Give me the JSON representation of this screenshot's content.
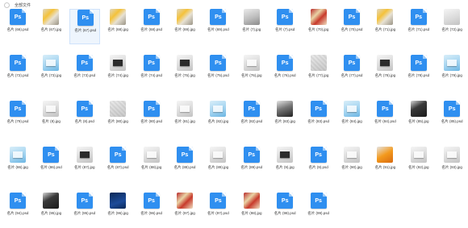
{
  "header": {
    "title": "全部文件"
  },
  "files": [
    {
      "label": "名片 (66).psd",
      "kind": "psd"
    },
    {
      "label": "名片 (67).jpg",
      "kind": "img",
      "thumb": "img-yellow"
    },
    {
      "label": "名片 (67).psd",
      "kind": "psd",
      "selected": true
    },
    {
      "label": "名片 (68).jpg",
      "kind": "img",
      "thumb": "img-yellow"
    },
    {
      "label": "名片 (68).psd",
      "kind": "psd"
    },
    {
      "label": "名片 (69).jpg",
      "kind": "img",
      "thumb": "img-yellow"
    },
    {
      "label": "名片 (69).psd",
      "kind": "psd"
    },
    {
      "label": "名片 (7).jpg",
      "kind": "img",
      "thumb": "img-gray"
    },
    {
      "label": "名片 (7).psd",
      "kind": "psd"
    },
    {
      "label": "名片 (70).jpg",
      "kind": "img",
      "thumb": "img-red"
    },
    {
      "label": "名片 (70).psd",
      "kind": "psd"
    },
    {
      "label": "名片 (71).jpg",
      "kind": "img",
      "thumb": "img-yellow"
    },
    {
      "label": "名片 (71).psd",
      "kind": "psd"
    },
    {
      "label": "名片 (72).jpg",
      "kind": "img",
      "thumb": "img-light"
    },
    {
      "label": "名片 (72).psd",
      "kind": "psd"
    },
    {
      "label": "名片 (73).jpg",
      "kind": "img",
      "thumb": "img-blue img-card"
    },
    {
      "label": "名片 (73).psd",
      "kind": "psd"
    },
    {
      "label": "名片 (74).jpg",
      "kind": "img",
      "thumb": "img-light img-darkcard"
    },
    {
      "label": "名片 (74).psd",
      "kind": "psd"
    },
    {
      "label": "名片 (75).jpg",
      "kind": "img",
      "thumb": "img-light img-darkcard"
    },
    {
      "label": "名片 (75).psd",
      "kind": "psd"
    },
    {
      "label": "名片 (76).jpg",
      "kind": "img",
      "thumb": "img-light img-card"
    },
    {
      "label": "名片 (76).psd",
      "kind": "psd"
    },
    {
      "label": "名片 (77).jpg",
      "kind": "img",
      "thumb": "img-pattern"
    },
    {
      "label": "名片 (77).psd",
      "kind": "psd"
    },
    {
      "label": "名片 (78).jpg",
      "kind": "img",
      "thumb": "img-light img-darkcard"
    },
    {
      "label": "名片 (78).psd",
      "kind": "psd"
    },
    {
      "label": "名片 (79).jpg",
      "kind": "img",
      "thumb": "img-blue img-card"
    },
    {
      "label": "名片 (79).psd",
      "kind": "psd"
    },
    {
      "label": "名片 (8).jpg",
      "kind": "img",
      "thumb": "img-light img-card"
    },
    {
      "label": "名片 (8).psd",
      "kind": "psd"
    },
    {
      "label": "名片 (80).jpg",
      "kind": "img",
      "thumb": "img-pattern"
    },
    {
      "label": "名片 (80).psd",
      "kind": "psd"
    },
    {
      "label": "名片 (81).jpg",
      "kind": "img",
      "thumb": "img-light img-card"
    },
    {
      "label": "名片 (82).jpg",
      "kind": "img",
      "thumb": "img-blue img-card"
    },
    {
      "label": "名片 (82).psd",
      "kind": "psd"
    },
    {
      "label": "名片 (83).jpg",
      "kind": "img",
      "thumb": "img-dark"
    },
    {
      "label": "名片 (83).psd",
      "kind": "psd"
    },
    {
      "label": "名片 (84).jpg",
      "kind": "img",
      "thumb": "img-blue img-card"
    },
    {
      "label": "名片 (84).psd",
      "kind": "psd"
    },
    {
      "label": "名片 (85).jpg",
      "kind": "img",
      "thumb": "img-black"
    },
    {
      "label": "名片 (85).psd",
      "kind": "psd"
    },
    {
      "label": "名片 (86).jpg",
      "kind": "img",
      "thumb": "img-blue img-card"
    },
    {
      "label": "名片 (86).psd",
      "kind": "psd"
    },
    {
      "label": "名片 (87).jpg",
      "kind": "img",
      "thumb": "img-light img-darkcard"
    },
    {
      "label": "名片 (87).psd",
      "kind": "psd"
    },
    {
      "label": "名片 (88).jpg",
      "kind": "img",
      "thumb": "img-light img-card"
    },
    {
      "label": "名片 (88).psd",
      "kind": "psd"
    },
    {
      "label": "名片 (89).jpg",
      "kind": "img",
      "thumb": "img-light img-card"
    },
    {
      "label": "名片 (89).psd",
      "kind": "psd"
    },
    {
      "label": "名片 (9).jpg",
      "kind": "img",
      "thumb": "img-light img-darkcard"
    },
    {
      "label": "名片 (9).psd",
      "kind": "psd"
    },
    {
      "label": "名片 (90).jpg",
      "kind": "img",
      "thumb": "img-light img-card"
    },
    {
      "label": "名片 (91).jpg",
      "kind": "img",
      "thumb": "img-orange"
    },
    {
      "label": "名片 (92).jpg",
      "kind": "img",
      "thumb": "img-light img-card"
    },
    {
      "label": "名片 (93).jpg",
      "kind": "img",
      "thumb": "img-light img-card"
    },
    {
      "label": "名片 (94).psd",
      "kind": "psd"
    },
    {
      "label": "名片 (95).jpg",
      "kind": "img",
      "thumb": "img-black"
    },
    {
      "label": "名片 (95).psd",
      "kind": "psd"
    },
    {
      "label": "名片 (96).jpg",
      "kind": "img",
      "thumb": "img-navy"
    },
    {
      "label": "名片 (96).psd",
      "kind": "psd"
    },
    {
      "label": "名片 (97).jpg",
      "kind": "img",
      "thumb": "img-red"
    },
    {
      "label": "名片 (97).psd",
      "kind": "psd"
    },
    {
      "label": "名片 (98).jpg",
      "kind": "img",
      "thumb": "img-red"
    },
    {
      "label": "名片 (98).psd",
      "kind": "psd"
    },
    {
      "label": "名片 (99).psd",
      "kind": "psd"
    }
  ]
}
